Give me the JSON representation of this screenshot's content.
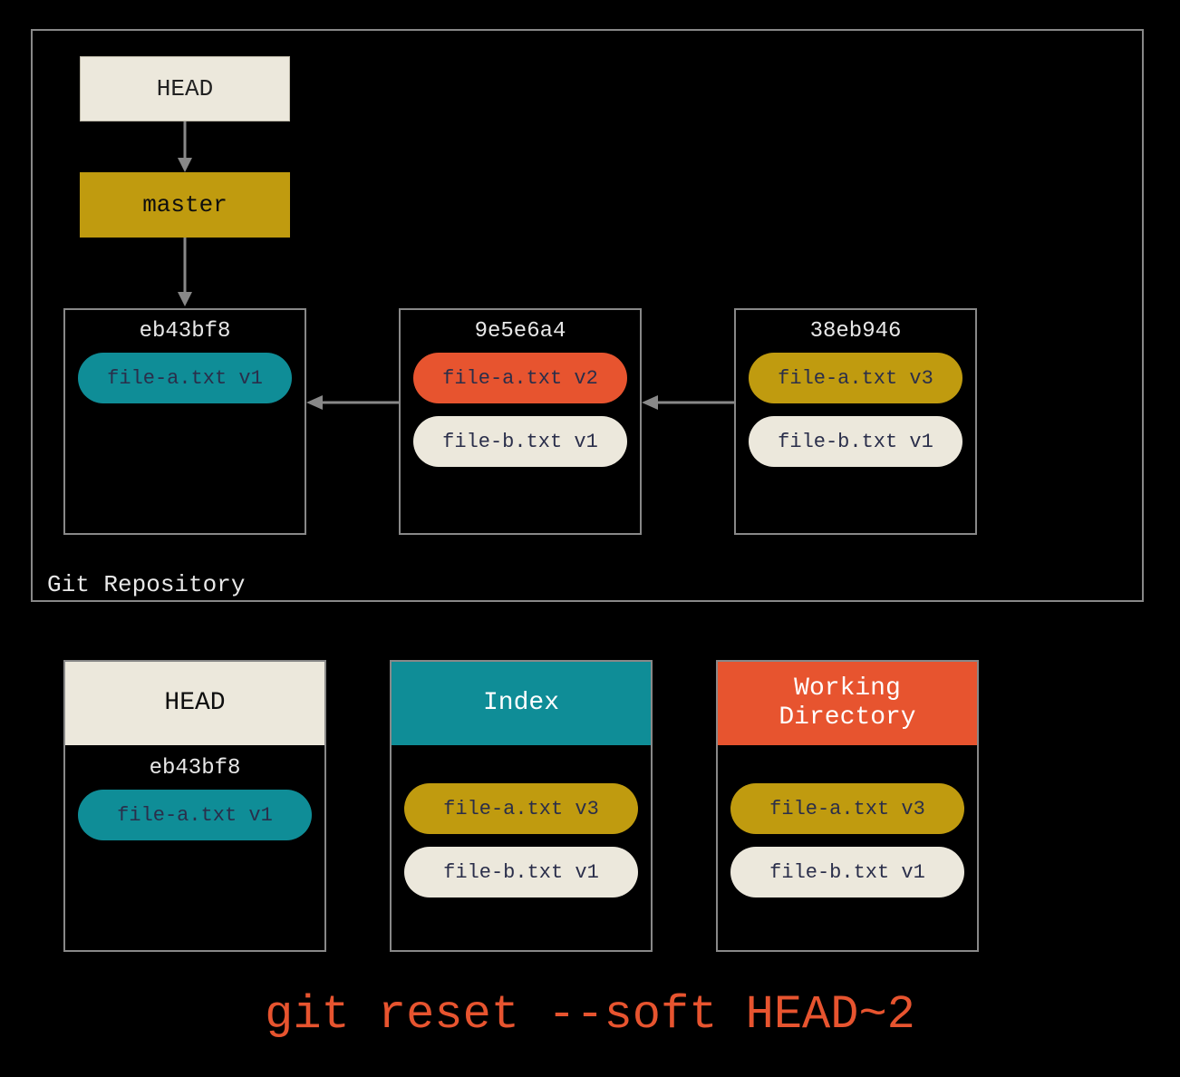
{
  "repo": {
    "label": "Git Repository",
    "head_label": "HEAD",
    "master_label": "master",
    "commits": [
      {
        "hash": "eb43bf8",
        "files": [
          {
            "text": "file-a.txt v1",
            "style": "teal"
          }
        ]
      },
      {
        "hash": "9e5e6a4",
        "files": [
          {
            "text": "file-a.txt v2",
            "style": "orange"
          },
          {
            "text": "file-b.txt v1",
            "style": "cream"
          }
        ]
      },
      {
        "hash": "38eb946",
        "files": [
          {
            "text": "file-a.txt v3",
            "style": "gold"
          },
          {
            "text": "file-b.txt v1",
            "style": "cream"
          }
        ]
      }
    ]
  },
  "trees": {
    "head": {
      "title": "HEAD",
      "hash": "eb43bf8",
      "files": [
        {
          "text": "file-a.txt v1",
          "style": "teal"
        }
      ]
    },
    "index": {
      "title": "Index",
      "files": [
        {
          "text": "file-a.txt v3",
          "style": "gold"
        },
        {
          "text": "file-b.txt v1",
          "style": "cream"
        }
      ]
    },
    "wd": {
      "title": "Working\nDirectory",
      "files": [
        {
          "text": "file-a.txt v3",
          "style": "gold"
        },
        {
          "text": "file-b.txt v1",
          "style": "cream"
        }
      ]
    }
  },
  "command": "git reset --soft HEAD~2",
  "colors": {
    "teal": "#0f8d97",
    "orange": "#e7542f",
    "gold": "#c09b0f",
    "cream": "#ece8dc",
    "border": "#888888",
    "bg": "#000000"
  },
  "chart_data": {
    "type": "diagram",
    "title": "git reset --soft HEAD~2",
    "nodes": [
      {
        "id": "head-ptr",
        "label": "HEAD"
      },
      {
        "id": "master-ptr",
        "label": "master"
      },
      {
        "id": "c1",
        "label": "eb43bf8",
        "files": [
          "file-a.txt v1"
        ]
      },
      {
        "id": "c2",
        "label": "9e5e6a4",
        "files": [
          "file-a.txt v2",
          "file-b.txt v1"
        ]
      },
      {
        "id": "c3",
        "label": "38eb946",
        "files": [
          "file-a.txt v3",
          "file-b.txt v1"
        ]
      },
      {
        "id": "tree-head",
        "label": "HEAD",
        "hash": "eb43bf8",
        "files": [
          "file-a.txt v1"
        ]
      },
      {
        "id": "tree-index",
        "label": "Index",
        "files": [
          "file-a.txt v3",
          "file-b.txt v1"
        ]
      },
      {
        "id": "tree-wd",
        "label": "Working Directory",
        "files": [
          "file-a.txt v3",
          "file-b.txt v1"
        ]
      }
    ],
    "edges": [
      {
        "from": "head-ptr",
        "to": "master-ptr"
      },
      {
        "from": "master-ptr",
        "to": "c1"
      },
      {
        "from": "c2",
        "to": "c1"
      },
      {
        "from": "c3",
        "to": "c2"
      }
    ]
  }
}
